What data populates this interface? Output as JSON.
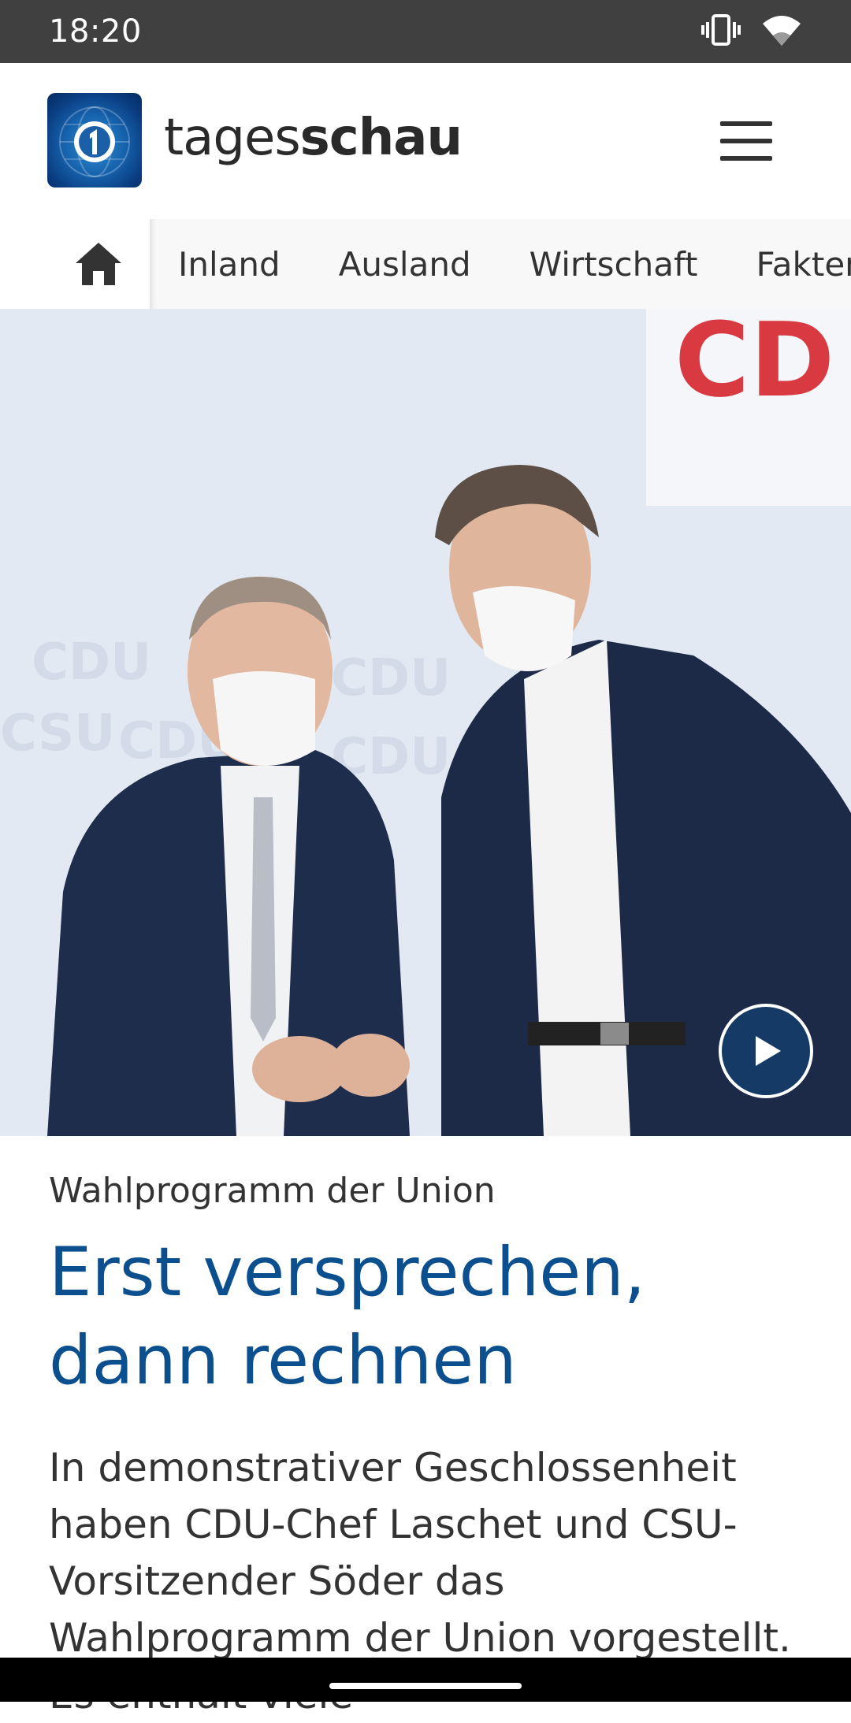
{
  "status_bar": {
    "time": "18:20",
    "icons": [
      "vibrate-icon",
      "wifi-icon"
    ]
  },
  "header": {
    "brand_light": "tages",
    "brand_bold": "schau",
    "menu_icon": "hamburger-menu-icon"
  },
  "tabs": {
    "home_icon": "home-icon",
    "items": [
      "Inland",
      "Ausland",
      "Wirtschaft",
      "Fakten"
    ]
  },
  "hero": {
    "play_icon": "play-icon"
  },
  "article": {
    "kicker": "Wahlprogramm der Union",
    "headline": "Erst versprechen, dann rechnen",
    "teaser": "In demonstrativer Geschlossenheit haben CDU-Chef Laschet und CSU-Vorsitzender Söder das Wahlprogramm der Union vorgestellt. Es enthält viele"
  },
  "colors": {
    "status_bar": "#404040",
    "headline": "#0b4f8f",
    "play_button": "#153a66"
  }
}
